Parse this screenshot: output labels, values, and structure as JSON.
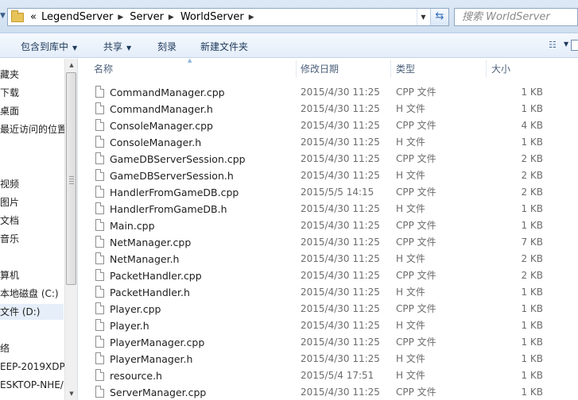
{
  "address": {
    "overflow": "«",
    "segments": [
      "LegendServer",
      "Server",
      "WorldServer"
    ],
    "search_placeholder": "搜索 WorldServer"
  },
  "toolbar": {
    "include_library": "包含到库中",
    "share": "共享",
    "burn": "刻录",
    "new_folder": "新建文件夹"
  },
  "nav": {
    "items": [
      {
        "label": "藏夹"
      },
      {
        "label": "下载"
      },
      {
        "label": "桌面"
      },
      {
        "label": "最近访问的位置"
      },
      {
        "label": "视频"
      },
      {
        "label": "图片"
      },
      {
        "label": "文档"
      },
      {
        "label": "音乐"
      },
      {
        "label": "算机"
      },
      {
        "label": "本地磁盘 (C:)"
      },
      {
        "label": "文件 (D:)"
      },
      {
        "label": "络"
      },
      {
        "label": "EEP-2019XDP("
      },
      {
        "label": "ESKTOP-NHE/"
      }
    ]
  },
  "columns": {
    "name": "名称",
    "date": "修改日期",
    "type": "类型",
    "size": "大小"
  },
  "files": [
    {
      "name": "CommandManager.cpp",
      "date": "2015/4/30 11:25",
      "type": "CPP 文件",
      "size": "1 KB"
    },
    {
      "name": "CommandManager.h",
      "date": "2015/4/30 11:25",
      "type": "H 文件",
      "size": "1 KB"
    },
    {
      "name": "ConsoleManager.cpp",
      "date": "2015/4/30 11:25",
      "type": "CPP 文件",
      "size": "4 KB"
    },
    {
      "name": "ConsoleManager.h",
      "date": "2015/4/30 11:25",
      "type": "H 文件",
      "size": "1 KB"
    },
    {
      "name": "GameDBServerSession.cpp",
      "date": "2015/4/30 11:25",
      "type": "CPP 文件",
      "size": "2 KB"
    },
    {
      "name": "GameDBServerSession.h",
      "date": "2015/4/30 11:25",
      "type": "H 文件",
      "size": "2 KB"
    },
    {
      "name": "HandlerFromGameDB.cpp",
      "date": "2015/5/5 14:15",
      "type": "CPP 文件",
      "size": "2 KB"
    },
    {
      "name": "HandlerFromGameDB.h",
      "date": "2015/4/30 11:25",
      "type": "H 文件",
      "size": "1 KB"
    },
    {
      "name": "Main.cpp",
      "date": "2015/4/30 11:25",
      "type": "CPP 文件",
      "size": "1 KB"
    },
    {
      "name": "NetManager.cpp",
      "date": "2015/4/30 11:25",
      "type": "CPP 文件",
      "size": "7 KB"
    },
    {
      "name": "NetManager.h",
      "date": "2015/4/30 11:25",
      "type": "H 文件",
      "size": "2 KB"
    },
    {
      "name": "PacketHandler.cpp",
      "date": "2015/4/30 11:25",
      "type": "CPP 文件",
      "size": "2 KB"
    },
    {
      "name": "PacketHandler.h",
      "date": "2015/4/30 11:25",
      "type": "H 文件",
      "size": "1 KB"
    },
    {
      "name": "Player.cpp",
      "date": "2015/4/30 11:25",
      "type": "CPP 文件",
      "size": "1 KB"
    },
    {
      "name": "Player.h",
      "date": "2015/4/30 11:25",
      "type": "H 文件",
      "size": "1 KB"
    },
    {
      "name": "PlayerManager.cpp",
      "date": "2015/4/30 11:25",
      "type": "CPP 文件",
      "size": "1 KB"
    },
    {
      "name": "PlayerManager.h",
      "date": "2015/4/30 11:25",
      "type": "H 文件",
      "size": "1 KB"
    },
    {
      "name": "resource.h",
      "date": "2015/5/4 17:51",
      "type": "H 文件",
      "size": "1 KB"
    },
    {
      "name": "ServerManager.cpp",
      "date": "2015/4/30 11:25",
      "type": "CPP 文件",
      "size": "1 KB"
    }
  ]
}
